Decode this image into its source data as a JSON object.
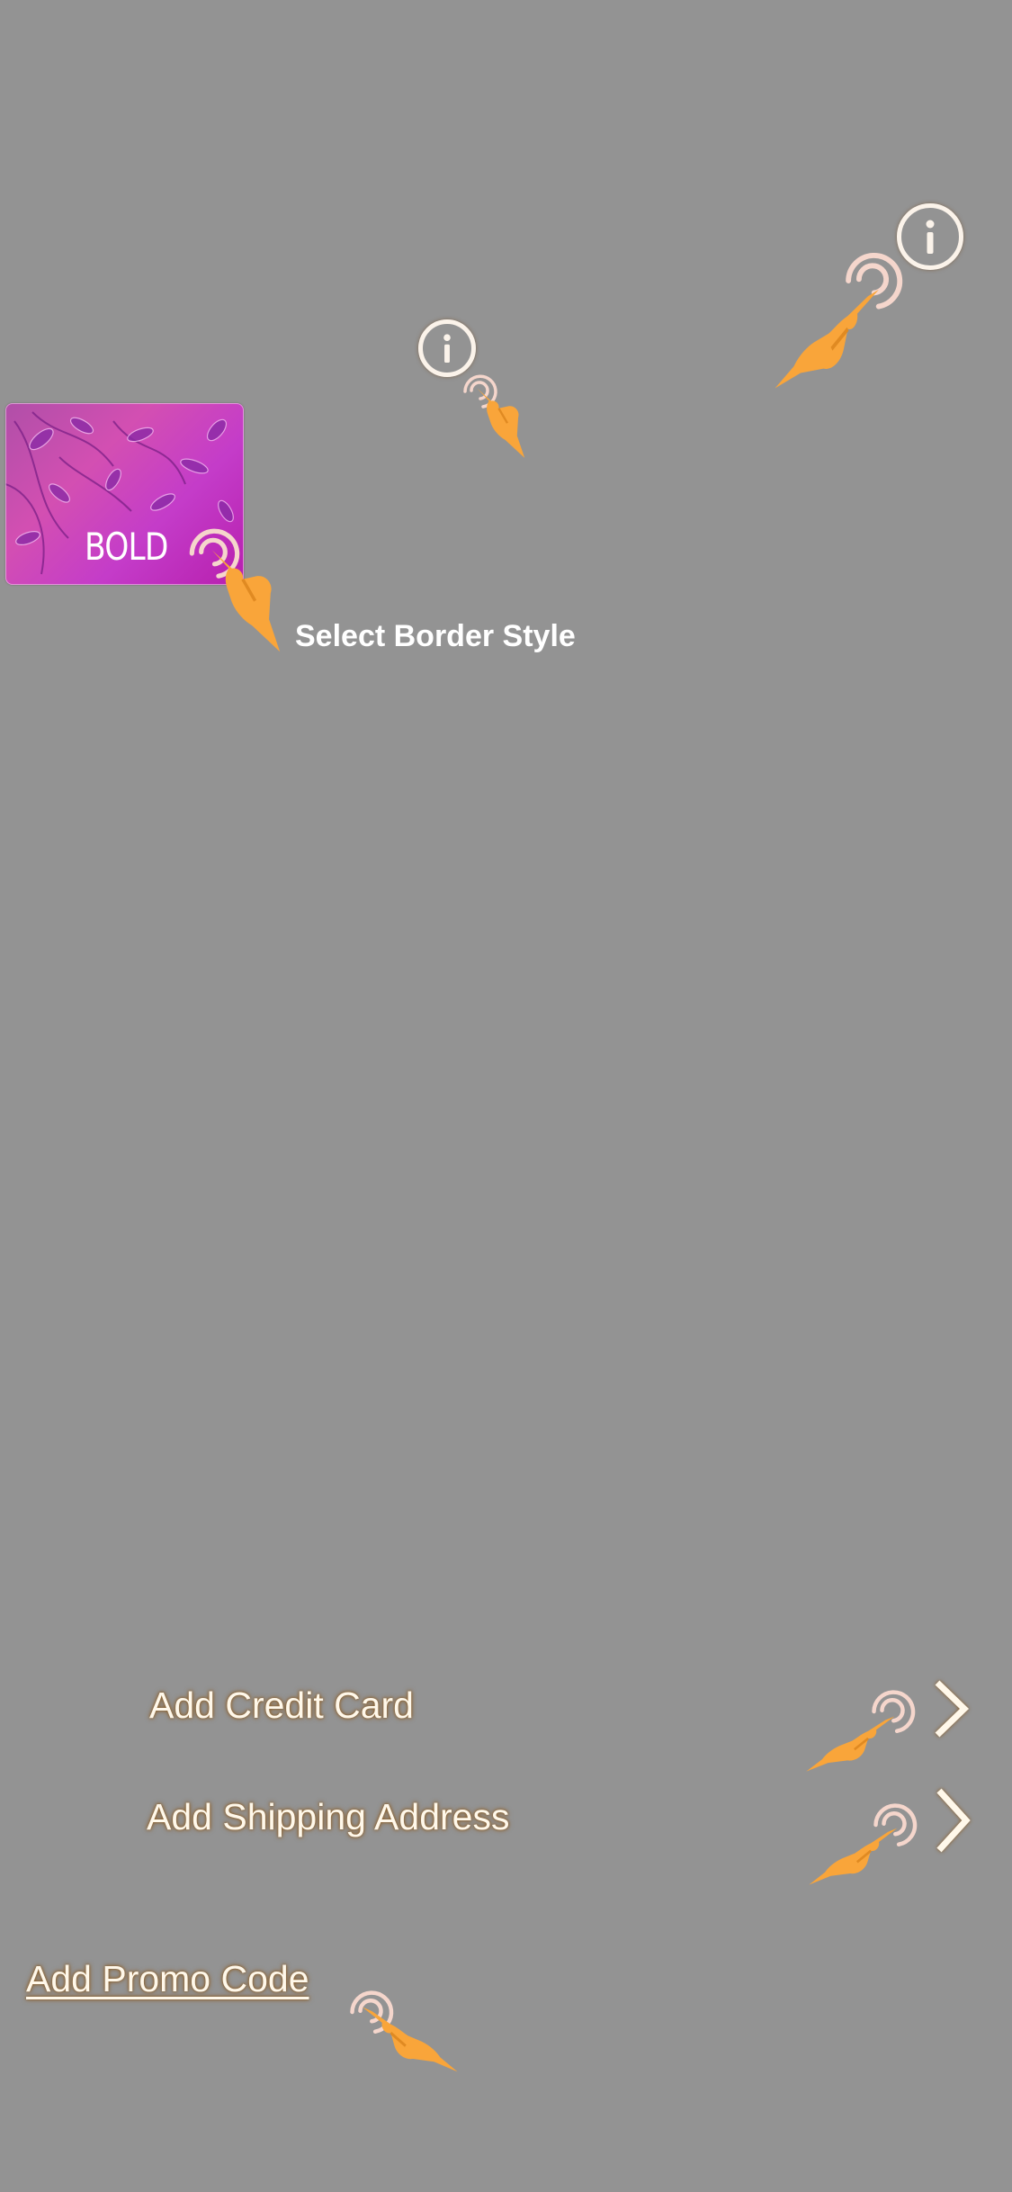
{
  "colors": {
    "background": "#939393",
    "hint_hand": "#f9a53a",
    "hint_ring": "#f5d6cc",
    "label_text": "#fff8ea",
    "card_pink": "#d34fb2"
  },
  "header": {
    "info_primary_icon": "info-icon",
    "info_secondary_icon": "info-icon"
  },
  "border_style": {
    "card_label": "BOLD",
    "title": "Select Border Style"
  },
  "payment": {
    "rows": [
      {
        "label": "Add Credit Card",
        "icon": "chevron-right-icon"
      },
      {
        "label": "Add Shipping Address",
        "icon": "chevron-right-icon"
      }
    ],
    "promo_label": "Add Promo Code"
  }
}
